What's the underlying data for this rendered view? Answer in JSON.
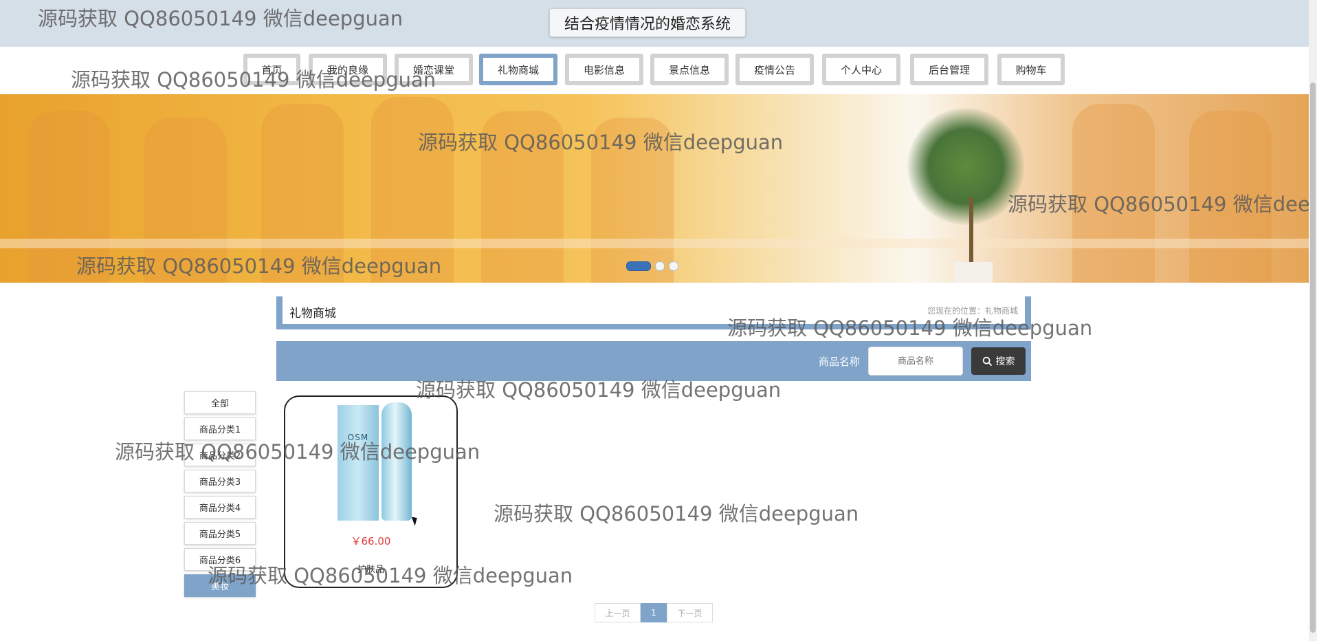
{
  "header": {
    "site_title": "结合疫情情况的婚恋系统"
  },
  "nav": [
    {
      "label": "首页"
    },
    {
      "label": "我的良缘"
    },
    {
      "label": "婚恋课堂"
    },
    {
      "label": "礼物商城",
      "active": true
    },
    {
      "label": "电影信息"
    },
    {
      "label": "景点信息"
    },
    {
      "label": "疫情公告"
    },
    {
      "label": "个人中心"
    },
    {
      "label": "后台管理"
    },
    {
      "label": "购物车"
    }
  ],
  "banner": {
    "slide_count": 3,
    "active_slide": 1
  },
  "breadcrumb": {
    "title": "礼物商城",
    "location": "您现在的位置：礼物商城"
  },
  "search": {
    "label": "商品名称",
    "placeholder": "商品名称",
    "button_label": "搜索"
  },
  "categories": [
    {
      "label": "全部"
    },
    {
      "label": "商品分类1"
    },
    {
      "label": "商品分类2"
    },
    {
      "label": "商品分类3"
    },
    {
      "label": "商品分类4"
    },
    {
      "label": "商品分类5"
    },
    {
      "label": "商品分类6"
    },
    {
      "label": "美妆",
      "active": true
    }
  ],
  "products": [
    {
      "brand": "OSM",
      "price": "￥66.00",
      "name": "护肤品"
    }
  ],
  "pagination": {
    "prev_label": "上一页",
    "current_page": "1",
    "next_label": "下一页"
  },
  "watermark": "源码获取 QQ86050149 微信deepguan",
  "colors": {
    "accent": "#7fa3c9",
    "price": "#e23a3a",
    "dark_button": "#3a3a3a",
    "topbar": "#d5dfe8"
  }
}
